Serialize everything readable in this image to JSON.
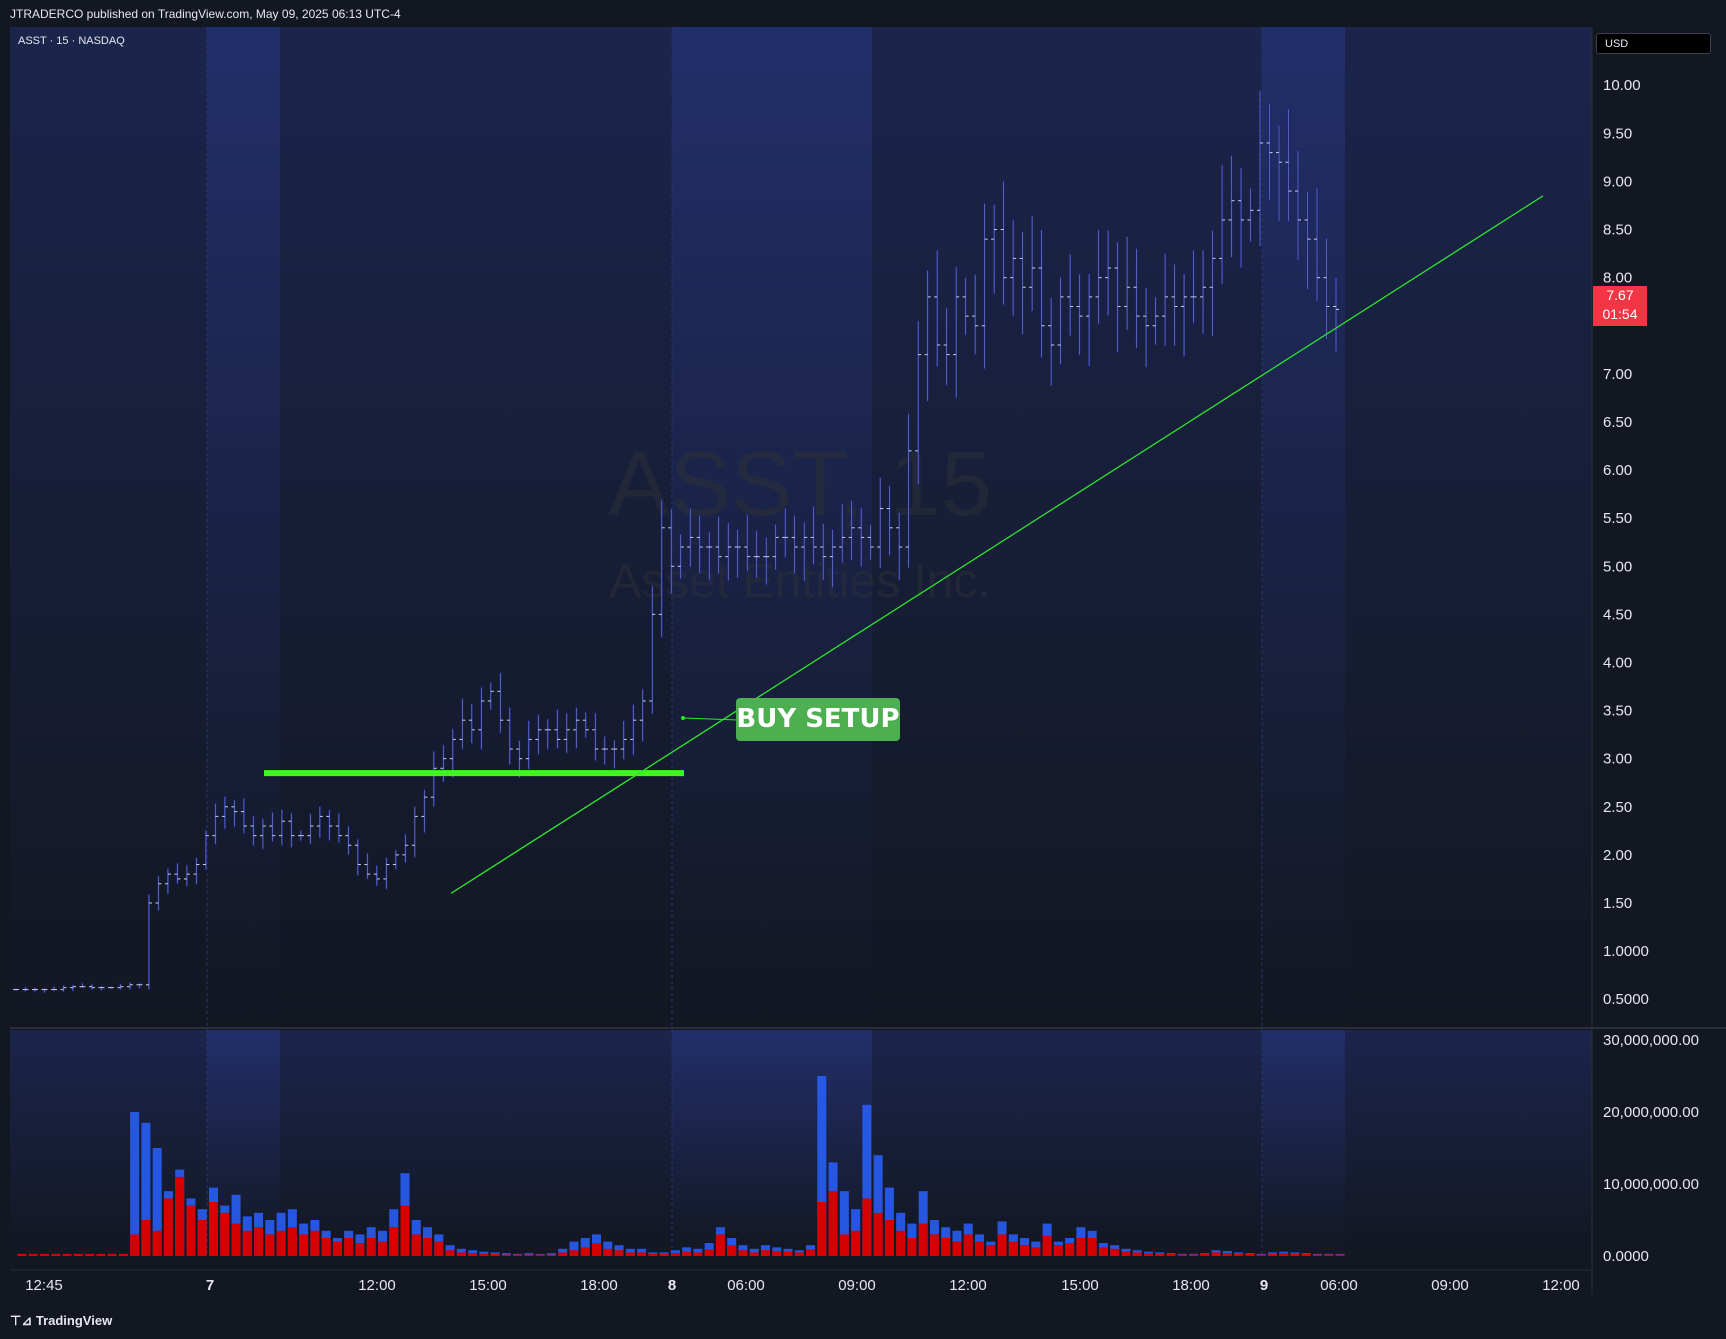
{
  "header": {
    "published": "JTRADERCO published on TradingView.com, May 09, 2025 06:13 UTC-4",
    "symbol_line": "ASST · 15 · NASDAQ",
    "currency": "USD"
  },
  "watermark": {
    "line1": "ASST, 15",
    "line2": "Asset Entities Inc."
  },
  "price_badge": {
    "price": "7.67",
    "countdown": "01:54",
    "color": "#f23645"
  },
  "annotation": {
    "label": "BUY SETUP",
    "color": "#4caf50"
  },
  "footer": {
    "brand": "TradingView"
  },
  "colors": {
    "background": "#131722",
    "session": "#1e2a5e",
    "bar": "#1a237e",
    "bar_tick": "#c8d0f0",
    "vol_up": "#2962ff",
    "vol_down": "#d50000",
    "trendline": "#2ee62e",
    "level": "#39ff14"
  },
  "chart_data": [
    {
      "type": "ohlc-bar",
      "title": "ASST, 15",
      "y_tick_labels": [
        "10.00",
        "9.50",
        "9.00",
        "8.50",
        "8.00",
        "7.00",
        "6.50",
        "6.00",
        "5.50",
        "5.00",
        "4.50",
        "4.00",
        "3.50",
        "3.00",
        "2.50",
        "2.00",
        "1.50",
        "1.0000",
        "0.5000"
      ],
      "x_tick_labels": [
        "12:45",
        "7",
        "12:00",
        "15:00",
        "18:00",
        "8",
        "06:00",
        "09:00",
        "12:00",
        "15:00",
        "18:00",
        "9",
        "06:00",
        "09:00",
        "12:00"
      ],
      "ylim": [
        0.45,
        10.2
      ],
      "last_price": 7.67,
      "price_path": [
        0.6,
        0.6,
        0.6,
        0.6,
        0.6,
        0.62,
        0.63,
        0.63,
        0.62,
        0.62,
        0.62,
        0.63,
        0.65,
        0.65,
        1.5,
        1.7,
        1.8,
        1.75,
        1.8,
        1.9,
        2.2,
        2.4,
        2.5,
        2.45,
        2.3,
        2.2,
        2.3,
        2.2,
        2.35,
        2.2,
        2.2,
        2.3,
        2.4,
        2.3,
        2.2,
        2.1,
        1.9,
        1.8,
        1.75,
        1.9,
        2.0,
        2.1,
        2.4,
        2.6,
        2.9,
        3.0,
        3.2,
        3.4,
        3.3,
        3.6,
        3.7,
        3.4,
        3.1,
        3.0,
        3.2,
        3.3,
        3.3,
        3.2,
        3.3,
        3.4,
        3.3,
        3.1,
        3.1,
        3.1,
        3.2,
        3.4,
        3.6,
        4.5,
        5.4,
        5.0,
        5.2,
        5.3,
        5.2,
        5.2,
        5.1,
        5.2,
        5.2,
        5.1,
        5.1,
        5.1,
        5.3,
        5.3,
        5.2,
        5.3,
        5.2,
        5.1,
        5.2,
        5.3,
        5.4,
        5.3,
        5.2,
        5.6,
        5.4,
        5.2,
        6.2,
        7.2,
        7.8,
        7.3,
        7.2,
        7.8,
        7.6,
        7.5,
        8.4,
        8.5,
        8.0,
        8.2,
        7.9,
        8.1,
        7.5,
        7.3,
        7.8,
        7.7,
        7.6,
        7.8,
        8.0,
        8.1,
        7.7,
        7.9,
        7.6,
        7.5,
        7.6,
        7.8,
        7.7,
        7.8,
        7.8,
        7.9,
        8.2,
        8.6,
        8.8,
        8.6,
        8.7,
        9.4,
        9.3,
        9.2,
        8.9,
        8.6,
        8.4,
        8.0,
        7.7,
        7.67
      ],
      "level_line": 2.85,
      "trendline": {
        "from": {
          "x": "14:00 May 7",
          "y": 1.6
        },
        "to": {
          "x": "12:30 May 9",
          "y": 8.85
        }
      }
    },
    {
      "type": "bar",
      "title": "Volume",
      "y_tick_labels": [
        "30,000,000.00",
        "20,000,000.00",
        "10,000,000.00",
        "0.0000"
      ],
      "ylim": [
        0,
        30000000
      ],
      "up_values": [
        0,
        0,
        0,
        0,
        0,
        0,
        0,
        0,
        0,
        0,
        20000000,
        18500000,
        15000000,
        9000000,
        12000000,
        8000000,
        6500000,
        9500000,
        7000000,
        8500000,
        5500000,
        6000000,
        5000000,
        6000000,
        6500000,
        4500000,
        5000000,
        3500000,
        2500000,
        3500000,
        3000000,
        4000000,
        3500000,
        6500000,
        11500000,
        5000000,
        4000000,
        3000000,
        1500000,
        1000000,
        800000,
        600000,
        500000,
        400000,
        300000,
        400000,
        300000,
        400000,
        1000000,
        2000000,
        2500000,
        3000000,
        2000000,
        1500000,
        1000000,
        1000000,
        500000,
        500000,
        800000,
        1200000,
        1000000,
        1800000,
        4000000,
        2500000,
        1500000,
        1000000,
        1500000,
        1200000,
        1000000,
        800000,
        1500000,
        25000000,
        13000000,
        9000000,
        6500000,
        21000000,
        14000000,
        9500000,
        6000000,
        4500000,
        9000000,
        5000000,
        4000000,
        3500000,
        4500000,
        3000000,
        2000000,
        4800000,
        3000000,
        2500000,
        2000000,
        4500000,
        2000000,
        2500000,
        4000000,
        3500000,
        1800000,
        1500000,
        1000000,
        800000,
        600000,
        500000,
        400000,
        300000,
        300000,
        400000,
        800000,
        700000,
        500000,
        400000,
        300000,
        500000,
        600000,
        500000,
        400000,
        300000,
        300000,
        300000
      ],
      "down_values": [
        300000,
        300000,
        300000,
        300000,
        300000,
        300000,
        300000,
        300000,
        300000,
        300000,
        3000000,
        5000000,
        3500000,
        8000000,
        11000000,
        7000000,
        5000000,
        7500000,
        6000000,
        4500000,
        3500000,
        4000000,
        3000000,
        3500000,
        4000000,
        3000000,
        3500000,
        2500000,
        2000000,
        2500000,
        1800000,
        2500000,
        2000000,
        4000000,
        7000000,
        3000000,
        2500000,
        2000000,
        800000,
        500000,
        400000,
        300000,
        300000,
        200000,
        200000,
        200000,
        200000,
        200000,
        500000,
        800000,
        1200000,
        1800000,
        1000000,
        800000,
        500000,
        500000,
        300000,
        300000,
        400000,
        600000,
        500000,
        900000,
        3000000,
        1500000,
        800000,
        500000,
        800000,
        700000,
        600000,
        500000,
        900000,
        7500000,
        9000000,
        3000000,
        3500000,
        8000000,
        6000000,
        5000000,
        3500000,
        2500000,
        4500000,
        3000000,
        2500000,
        2000000,
        3000000,
        2000000,
        1500000,
        3000000,
        2000000,
        1500000,
        1200000,
        2800000,
        1500000,
        1800000,
        2500000,
        2500000,
        1200000,
        1000000,
        600000,
        500000,
        400000,
        300000,
        300000,
        200000,
        200000,
        300000,
        500000,
        400000,
        300000,
        300000,
        200000,
        300000,
        400000,
        300000,
        300000,
        200000,
        200000,
        200000
      ]
    }
  ]
}
